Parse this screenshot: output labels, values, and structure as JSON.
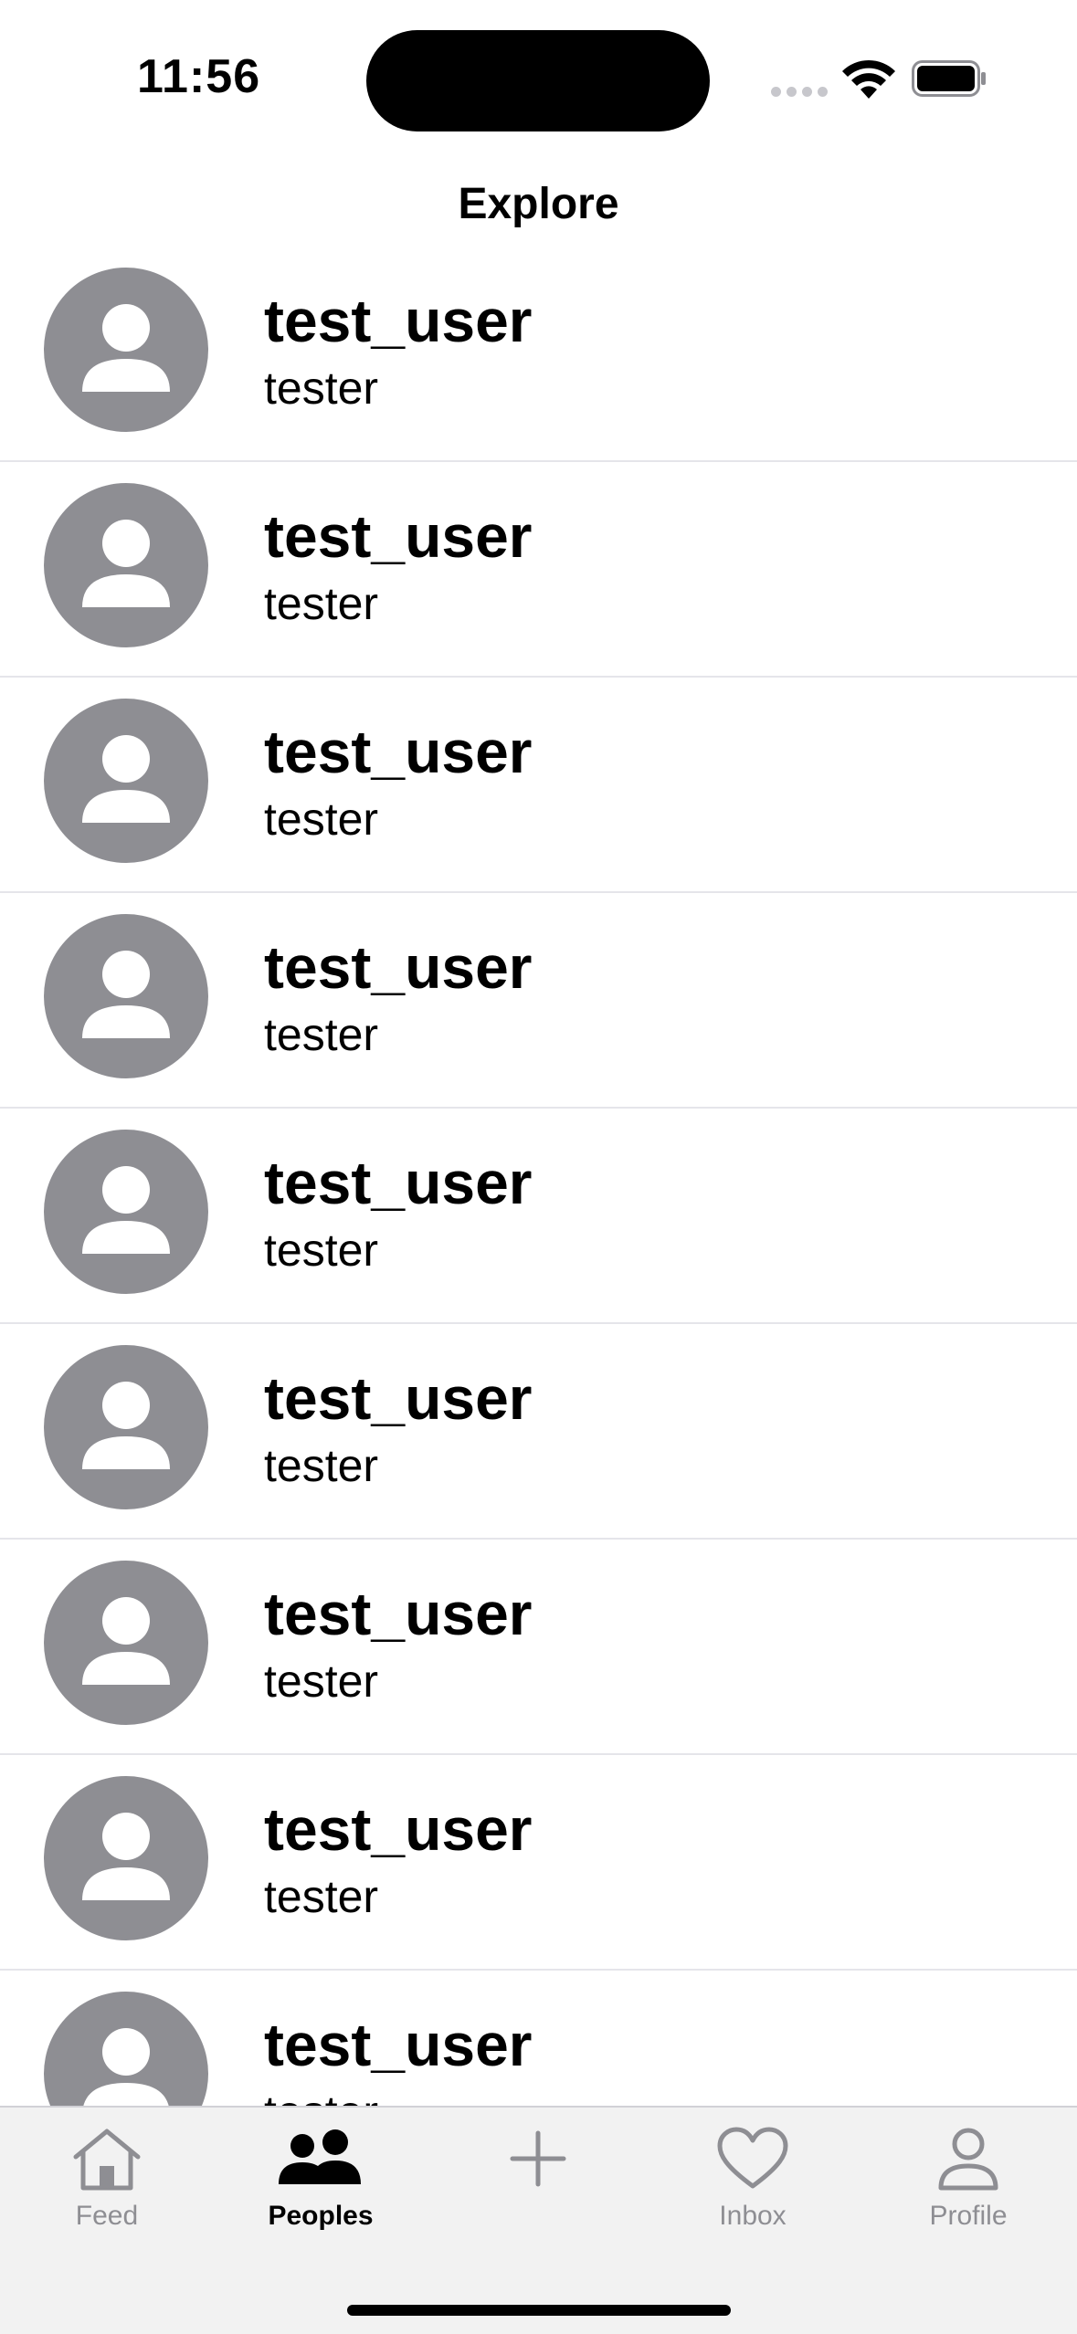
{
  "status_bar": {
    "time": "11:56"
  },
  "nav": {
    "title": "Explore"
  },
  "users": [
    {
      "name": "test_user",
      "subtitle": "tester"
    },
    {
      "name": "test_user",
      "subtitle": "tester"
    },
    {
      "name": "test_user",
      "subtitle": "tester"
    },
    {
      "name": "test_user",
      "subtitle": "tester"
    },
    {
      "name": "test_user",
      "subtitle": "tester"
    },
    {
      "name": "test_user",
      "subtitle": "tester"
    },
    {
      "name": "test_user",
      "subtitle": "tester"
    },
    {
      "name": "test_user",
      "subtitle": "tester"
    },
    {
      "name": "test_user",
      "subtitle": "tester"
    }
  ],
  "tabs": [
    {
      "label": "Feed",
      "icon": "house-icon",
      "active": false
    },
    {
      "label": "Peoples",
      "icon": "people-icon",
      "active": true
    },
    {
      "label": "",
      "icon": "plus-icon",
      "active": false
    },
    {
      "label": "Inbox",
      "icon": "heart-icon",
      "active": false
    },
    {
      "label": "Profile",
      "icon": "person-icon",
      "active": false
    }
  ],
  "colors": {
    "avatar_bg": "#8e8e93",
    "inactive_tab": "#8e8e93",
    "active_tab": "#000000",
    "separator": "#e5e5ea"
  }
}
